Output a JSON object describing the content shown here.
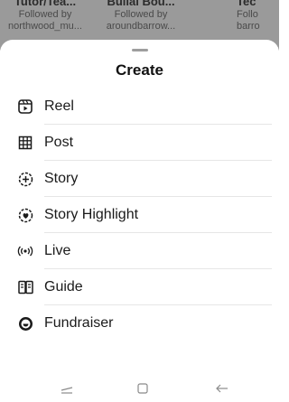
{
  "background_suggestions": [
    {
      "name": "Tutor/Tea...",
      "subtitle_1": "Followed by",
      "subtitle_2": "northwood_mu..."
    },
    {
      "name": "Bullai Bou...",
      "subtitle_1": "Followed by",
      "subtitle_2": "aroundbarrow..."
    },
    {
      "name": "Tec",
      "subtitle_1": "Follo",
      "subtitle_2": "barro"
    }
  ],
  "sheet": {
    "title": "Create",
    "items": [
      {
        "label": "Reel",
        "icon": "reel-icon"
      },
      {
        "label": "Post",
        "icon": "grid-post-icon"
      },
      {
        "label": "Story",
        "icon": "story-add-icon"
      },
      {
        "label": "Story Highlight",
        "icon": "highlight-heart-icon"
      },
      {
        "label": "Live",
        "icon": "live-broadcast-icon"
      },
      {
        "label": "Guide",
        "icon": "guide-book-icon"
      },
      {
        "label": "Fundraiser",
        "icon": "fundraiser-smile-icon"
      }
    ]
  },
  "navbar": {
    "buttons": [
      "recents-icon",
      "home-icon",
      "back-icon"
    ]
  },
  "colors": {
    "sheet_bg": "#ffffff",
    "backdrop": "#9a9a9a",
    "divider": "#e6e6e6",
    "text": "#1a1a1a"
  }
}
